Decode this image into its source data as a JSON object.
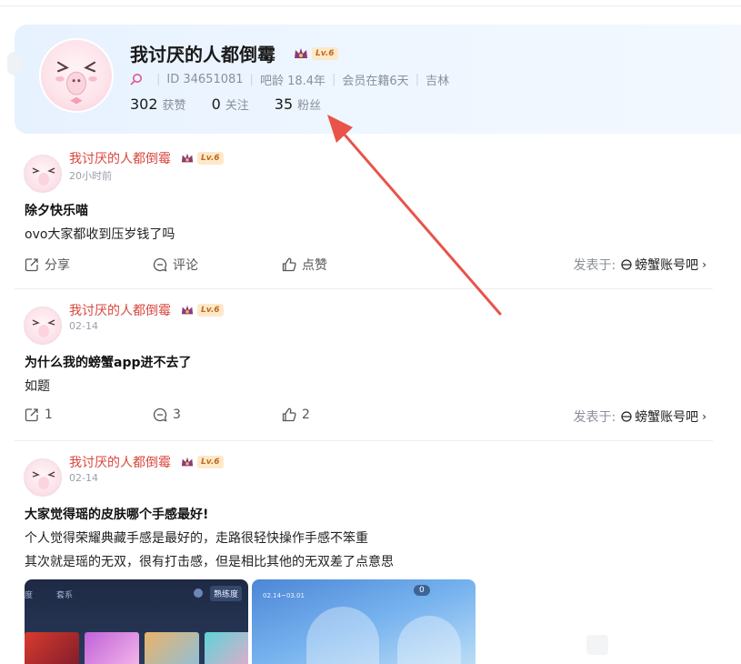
{
  "profile": {
    "username": "我讨厌的人都倒霉",
    "level": "Lv.6",
    "id_text": "ID 34651081",
    "bar_age": "吧龄 18.4年",
    "membership": "会员在籍6天",
    "location": "吉林",
    "stats": [
      {
        "num": "302",
        "label": "获赞"
      },
      {
        "num": "0",
        "label": "关注"
      },
      {
        "num": "35",
        "label": "粉丝"
      }
    ]
  },
  "posts": [
    {
      "author": "我讨厌的人都倒霉",
      "level": "Lv.6",
      "time": "20小时前",
      "title": "除夕快乐喵",
      "body": [
        "ovo大家都收到压岁钱了吗"
      ],
      "share": "分享",
      "comment": "评论",
      "like": "点赞",
      "posted_in_label": "发表于:",
      "forum": "螃蟹账号吧"
    },
    {
      "author": "我讨厌的人都倒霉",
      "level": "Lv.6",
      "time": "02-14",
      "title": "为什么我的螃蟹app进不去了",
      "body": [
        "如题"
      ],
      "share": "1",
      "comment": "3",
      "like": "2",
      "posted_in_label": "发表于:",
      "forum": "螃蟹账号吧"
    },
    {
      "author": "我讨厌的人都倒霉",
      "level": "Lv.6",
      "time": "02-14",
      "title": "大家觉得瑶的皮肤哪个手感最好!",
      "body": [
        "个人觉得荣耀典藏手感是最好的，走路很轻快操作手感不笨重",
        "其次就是瑶的无双，很有打击感，但是相比其他的无双差了点意思"
      ]
    }
  ],
  "thumb1": {
    "tab_a": "度",
    "tab_b": "套系",
    "badge": "熟练度"
  },
  "thumb2": {
    "date": "02.14~03.01",
    "count": "0"
  },
  "colors": {
    "accent_red": "#d9463c",
    "arrow": "#e8534a",
    "lv_bg": "#fde9c9"
  }
}
